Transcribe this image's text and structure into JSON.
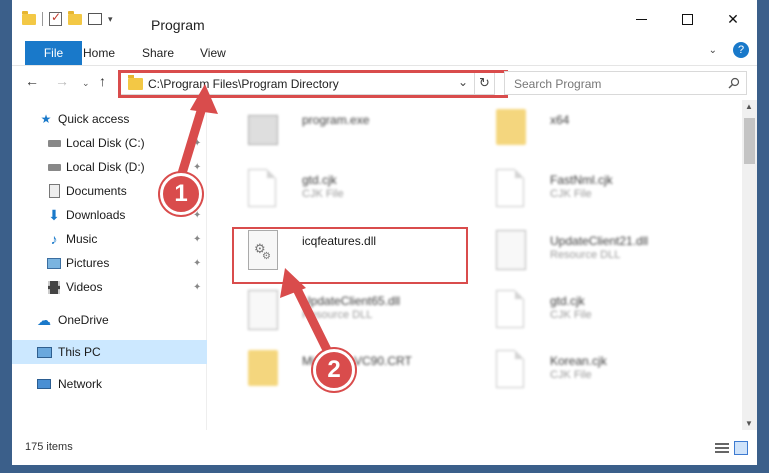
{
  "window": {
    "title": "Program",
    "min_label": "",
    "close_label": "✕"
  },
  "ribbon": {
    "file": "File",
    "home": "Home",
    "share": "Share",
    "view": "View",
    "help": "?"
  },
  "nav": {
    "back": "←",
    "forward": "→",
    "recent": "⌄",
    "up": "↑"
  },
  "address": {
    "path": "C:\\Program Files\\Program Directory",
    "chevron": "⌄",
    "refresh": "↻"
  },
  "search": {
    "placeholder": "Search Program"
  },
  "sidebar": {
    "items": [
      {
        "label": "Quick access",
        "icon": "star-icon"
      },
      {
        "label": "Local Disk (C:)",
        "icon": "drive-icon"
      },
      {
        "label": "Local Disk (D:)",
        "icon": "drive-icon"
      },
      {
        "label": "Documents",
        "icon": "documents-icon"
      },
      {
        "label": "Downloads",
        "icon": "downloads-icon"
      },
      {
        "label": "Music",
        "icon": "music-icon"
      },
      {
        "label": "Pictures",
        "icon": "pictures-icon"
      },
      {
        "label": "Videos",
        "icon": "videos-icon"
      },
      {
        "label": "OneDrive",
        "icon": "cloud-icon"
      },
      {
        "label": "This PC",
        "icon": "computer-icon"
      },
      {
        "label": "Network",
        "icon": "network-icon"
      }
    ],
    "pin": "📌"
  },
  "files": [
    {
      "name": "program.exe",
      "type": ""
    },
    {
      "name": "x64",
      "type": ""
    },
    {
      "name": "gtd.cjk",
      "type": "CJK File"
    },
    {
      "name": "FastNml.cjk",
      "type": "CJK File"
    },
    {
      "name": "icqfeatures.dll",
      "type": ""
    },
    {
      "name": "UpdateClient21.dll",
      "type": "Resource DLL"
    },
    {
      "name": "UpdateClient65.dll",
      "type": "Resource DLL"
    },
    {
      "name": "gtd.cjk",
      "type": "CJK File"
    },
    {
      "name": "Microsoft.VC90.CRT",
      "type": ""
    },
    {
      "name": "Korean.cjk",
      "type": "CJK File"
    }
  ],
  "status": {
    "item_count": "175 items"
  },
  "callouts": {
    "one": "1",
    "two": "2"
  },
  "colors": {
    "accent": "#1979ca",
    "callout": "#d94c4c",
    "selected": "#cce8ff",
    "frame": "#3b5f8a"
  }
}
